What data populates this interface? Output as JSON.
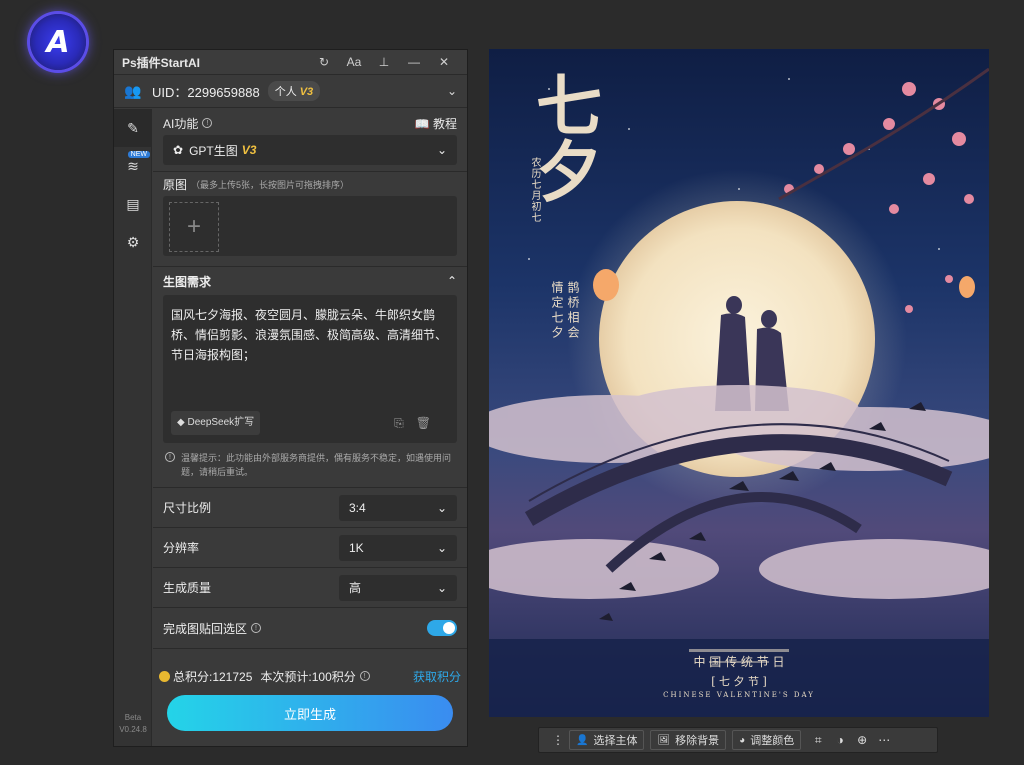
{
  "panel": {
    "title": "Ps插件StartAI",
    "uid": "UID：2299659888",
    "badge_label": "个人",
    "badge_tier": "V3",
    "version": [
      "Beta",
      "V0.24.8"
    ],
    "sidebar_new_badge": "NEW"
  },
  "ai": {
    "label": "AI功能",
    "tutorial": "教程",
    "model": "GPT生图",
    "model_tier": "V3"
  },
  "upload": {
    "title": "原图",
    "hint": "（最多上传5张，长按图片可拖拽排序）"
  },
  "prompt": {
    "header": "生图需求",
    "text": "国风七夕海报、夜空圆月、朦胧云朵、牛郎织女鹊桥、情侣剪影、浪漫氛围感、极简高级、高清细节、节日海报构图；",
    "deepseek": "DeepSeek扩写",
    "tip": "温馨提示：此功能由外部服务商提供，偶有服务不稳定，如遇使用问题，请稍后重试。"
  },
  "options": {
    "ratio_label": "尺寸比例",
    "ratio_value": "3:4",
    "res_label": "分辨率",
    "res_value": "1K",
    "quality_label": "生成质量",
    "quality_value": "高",
    "paste_label": "完成图贴回选区"
  },
  "credits": {
    "total": "总积分:121725",
    "estimate": "本次预计:100积分",
    "get": "获取积分",
    "generate": "立即生成"
  },
  "poster": {
    "big_char": "七夕",
    "lunar": "农历七月初七",
    "poem_left": "情定七夕",
    "poem_right": "鹊桥相会",
    "line1": "中 国 传 统 节 日",
    "line2": "[ 七 夕 节 ]",
    "line3": "CHINESE VALENTINE'S DAY"
  },
  "toolbar": {
    "select_subject": "选择主体",
    "remove_bg": "移除背景",
    "adjust_color": "调整颜色"
  },
  "colors": {
    "accent": "#2ea8e8",
    "tier_gold": "#f0c040"
  }
}
